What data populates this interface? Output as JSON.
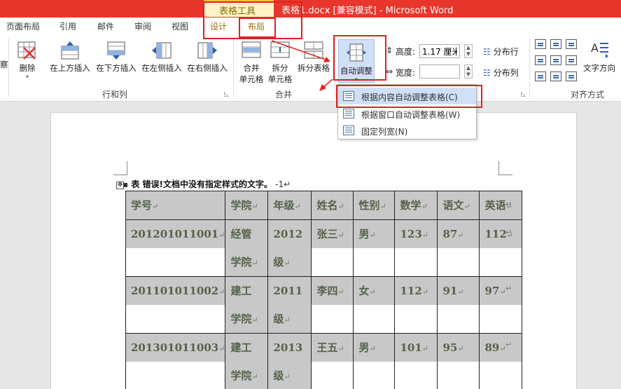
{
  "window": {
    "title": "表格1.docx [兼容模式] -  Microsoft Word",
    "context_tab_header": "表格工具"
  },
  "tabs": {
    "page_layout": "页面布局",
    "references": "引用",
    "mailings": "邮件",
    "review": "审阅",
    "view": "视图",
    "design": "设计",
    "layout": "布局"
  },
  "ribbon": {
    "edge_label": "察",
    "delete": "删除",
    "insert_above": "在上方插入",
    "insert_below": "在下方插入",
    "insert_left": "在左侧插入",
    "insert_right": "在右侧插入",
    "group_rows_cols": "行和列",
    "merge_line1": "合并",
    "merge_line2": "单元格",
    "split_line1": "拆分",
    "split_line2": "单元格",
    "split_table": "拆分表格",
    "group_merge": "合并",
    "autofit": "自动调整",
    "height_label": "高度:",
    "height_value": "1.17 厘米",
    "width_label": "宽度:",
    "width_value": "",
    "distribute_rows": "分布行",
    "distribute_cols": "分布列",
    "text_direction": "文字方向",
    "group_alignment": "对齐方式"
  },
  "autofit_menu": {
    "items": [
      "根据内容自动调整表格(C)",
      "根据窗口自动调整表格(W)",
      "固定列宽(N)"
    ]
  },
  "document": {
    "caption_prefix": "表",
    "caption_error": "错误!文档中没有指定样式的文字。",
    "caption_suffix": "-1",
    "table": {
      "headers": [
        "学号",
        "学院",
        "年级",
        "姓名",
        "性别",
        "数学",
        "语文",
        "英语"
      ],
      "rows": [
        [
          "201201011001",
          "经管",
          "学院",
          "2012",
          "级",
          "张三",
          "男",
          "123",
          "87",
          "112"
        ],
        [
          "201101011002",
          "建工",
          "学院",
          "2011",
          "级",
          "李四",
          "女",
          "112",
          "91",
          "97"
        ],
        [
          "201301011003",
          "建工",
          "学院",
          "2013",
          "级",
          "王五",
          "男",
          "101",
          "95",
          "89"
        ]
      ]
    }
  },
  "colors": {
    "title_bar": "#e8362d",
    "annotation_red": "#e02020",
    "highlight": "#cfe0f7",
    "cell_shade": "#c8c8c8"
  }
}
